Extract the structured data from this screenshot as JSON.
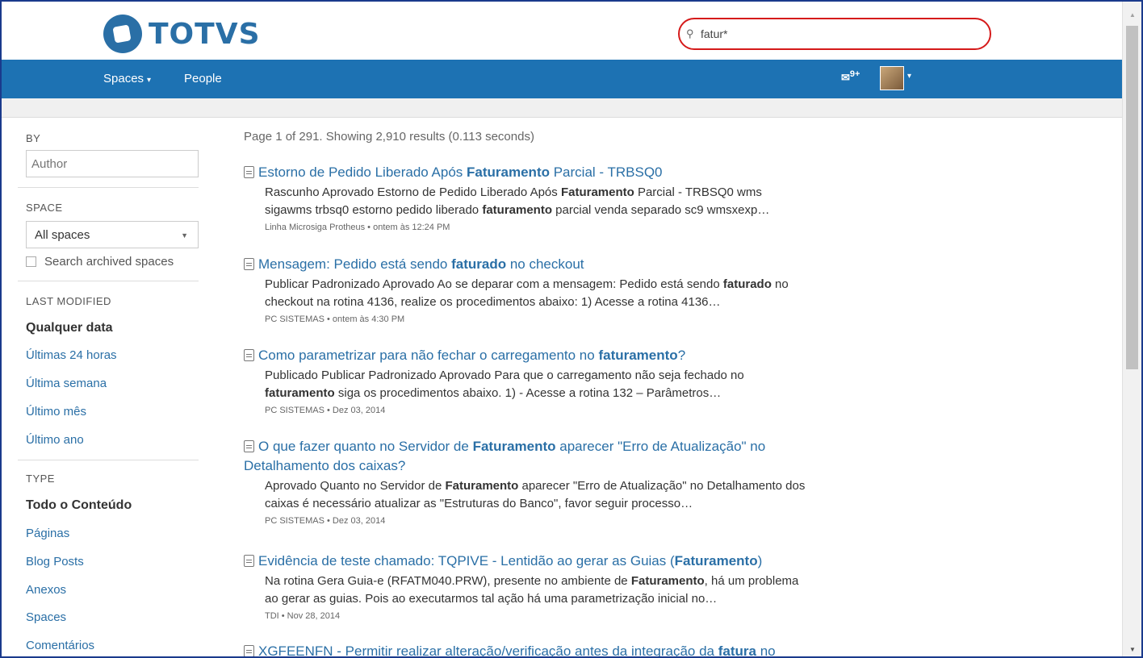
{
  "header": {
    "logo_text": "TOTVS",
    "search_value": "fatur*",
    "search_icon": "search-icon"
  },
  "nav": {
    "spaces_label": "Spaces",
    "people_label": "People",
    "notifications_badge": "9+",
    "colors": {
      "navbar": "#1d72b3",
      "link": "#2a6fa6",
      "highlight_ring": "#d51a1a"
    }
  },
  "sidebar": {
    "by_heading": "BY",
    "author_placeholder": "Author",
    "space_heading": "SPACE",
    "space_selected": "All spaces",
    "archived_label": "Search archived spaces",
    "last_modified_heading": "LAST MODIFIED",
    "last_modified_options": [
      "Qualquer data",
      "Últimas 24 horas",
      "Última semana",
      "Último mês",
      "Último ano"
    ],
    "type_heading": "TYPE",
    "type_options": [
      "Todo o Conteúdo",
      "Páginas",
      "Blog Posts",
      "Anexos",
      "Spaces",
      "Comentários"
    ]
  },
  "results": {
    "summary": "Page 1 of 291. Showing 2,910 results (0.113 seconds)",
    "items": [
      {
        "title_pre": "Estorno de Pedido Liberado Após ",
        "title_bold": "Faturamento",
        "title_post": " Parcial - TRBSQ0",
        "line1_pre": "Rascunho Aprovado Estorno de Pedido Liberado Após ",
        "line1_bold": "Faturamento",
        "line1_post": " Parcial - TRBSQ0 wms",
        "line2_pre": "sigawms trbsq0 estorno pedido liberado ",
        "line2_bold": "faturamento",
        "line2_post": " parcial venda separado sc9 wmsxexp…",
        "meta": "Linha Microsiga Protheus • ontem às 12:24 PM"
      },
      {
        "title_pre": "Mensagem: Pedido está sendo ",
        "title_bold": "faturado",
        "title_post": " no checkout",
        "line1_pre": "Publicar Padronizado Aprovado Ao se deparar com a mensagem: Pedido está sendo ",
        "line1_bold": "faturado",
        "line1_post": " no",
        "line2_pre": "checkout na rotina 4136, realize os procedimentos abaixo: 1) Acesse a rotina 4136…",
        "line2_bold": "",
        "line2_post": "",
        "meta": "PC SISTEMAS • ontem às 4:30 PM"
      },
      {
        "title_pre": "Como parametrizar para não fechar o carregamento no ",
        "title_bold": "faturamento",
        "title_post": "?",
        "line1_pre": "Publicado Publicar Padronizado Aprovado Para que o carregamento não seja fechado no",
        "line1_bold": "",
        "line1_post": "",
        "line2_pre": "",
        "line2_bold": "faturamento",
        "line2_post": " siga os procedimentos abaixo. 1) - Acesse a rotina 132 – Parâmetros…",
        "meta": "PC SISTEMAS • Dez 03, 2014"
      },
      {
        "title_pre": "O que fazer quanto no Servidor de ",
        "title_bold": "Faturamento",
        "title_post": " aparecer \"Erro de Atualização\" no Detalhamento dos caixas?",
        "line1_pre": "Aprovado Quanto no Servidor de ",
        "line1_bold": "Faturamento",
        "line1_post": " aparecer \"Erro de Atualização\" no Detalhamento dos",
        "line2_pre": "caixas é necessário atualizar as \"Estruturas do Banco\", favor seguir processo…",
        "line2_bold": "",
        "line2_post": "",
        "meta": "PC SISTEMAS • Dez 03, 2014"
      },
      {
        "title_pre": "Evidência de teste chamado: TQPIVE - Lentidão ao gerar as Guias (",
        "title_bold": "Faturamento",
        "title_post": ")",
        "line1_pre": "Na rotina Gera Guia-e (RFATM040.PRW), presente no ambiente de ",
        "line1_bold": "Faturamento",
        "line1_post": ", há um problema",
        "line2_pre": "ao gerar as guias. Pois ao executarmos tal ação há uma parametrização inicial no…",
        "line2_bold": "",
        "line2_post": "",
        "meta": "TDI • Nov 28, 2014"
      },
      {
        "title_pre": "XGFEENFN - Permitir realizar alteração/verificação antes da integração da ",
        "title_bold": "fatura",
        "title_post": " no",
        "line1_pre": "",
        "line1_bold": "",
        "line1_post": "",
        "line2_pre": "",
        "line2_bold": "",
        "line2_post": "",
        "meta": ""
      }
    ]
  }
}
